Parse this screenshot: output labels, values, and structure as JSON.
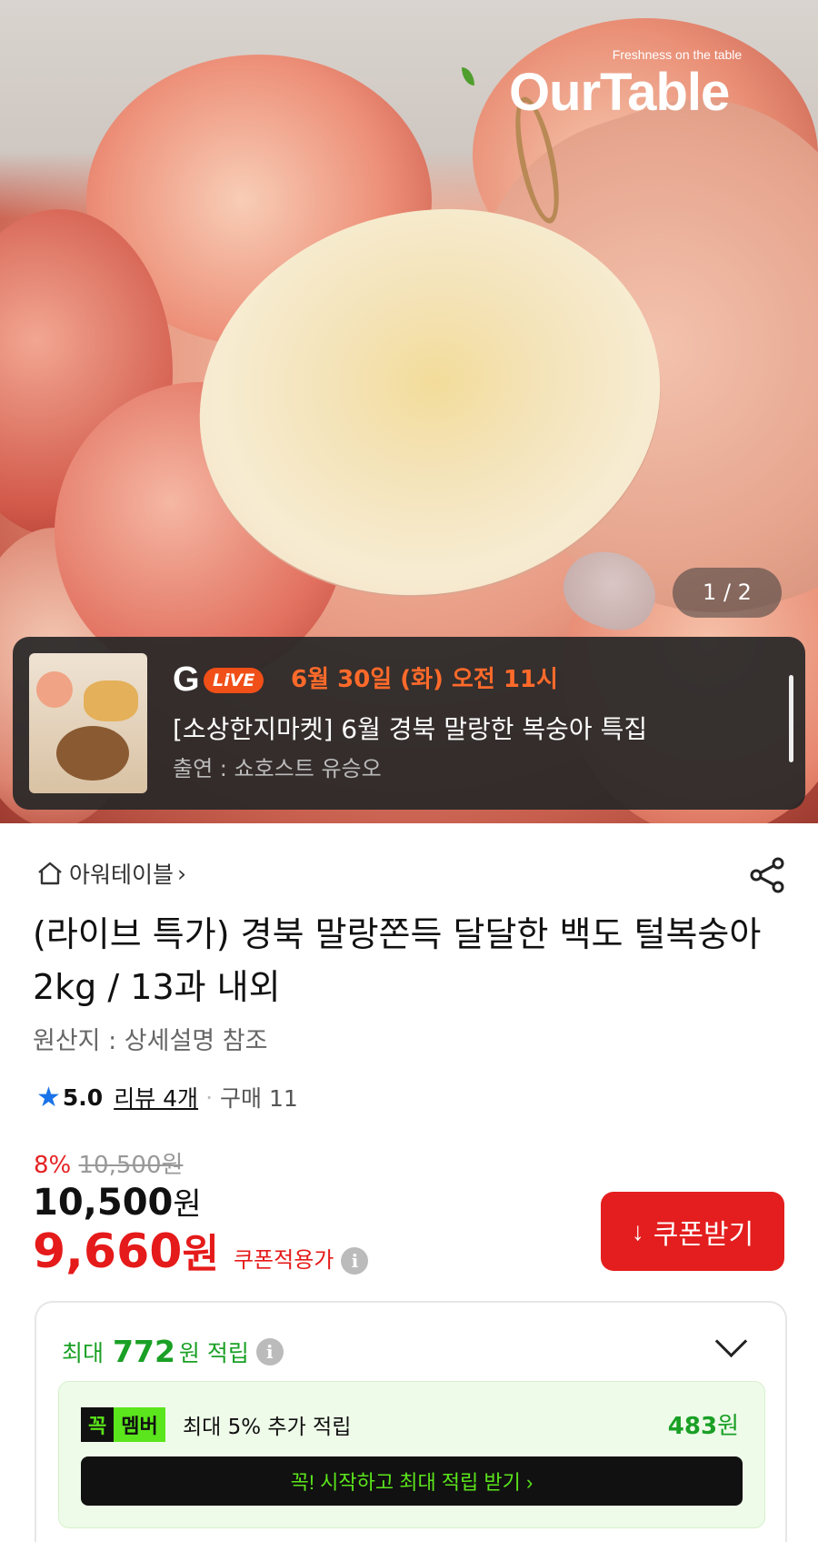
{
  "hero": {
    "logo_tagline": "Freshness on the table",
    "logo_text": "OurTable",
    "pager": "1 / 2"
  },
  "live": {
    "brand_g": "G",
    "brand_badge": "LiVE",
    "date": "6월 30일 (화) 오전 11시",
    "title": "[소상한지마켓] 6월 경북 말랑한 복숭아 특집",
    "cast": "출연 : 쇼호스트 유승오"
  },
  "product": {
    "seller": "아워테이블",
    "seller_chevron": "›",
    "title": "(라이브 특가) 경북 말랑쫀득 달달한 백도 털복숭아 2kg / 13과 내외",
    "origin": "원산지 : 상세설명 참조",
    "rating_star": "★",
    "rating": "5.0",
    "review": "리뷰 4개",
    "dot": "·",
    "purchases": "구매 11"
  },
  "pricing": {
    "discount_pct": "8%",
    "original_price": "10,500",
    "original_unit": "원",
    "price": "10,500",
    "price_unit": "원",
    "coupon_price": "9,660",
    "coupon_unit": "원",
    "coupon_label": "쿠폰적용가",
    "info_glyph": "i",
    "coupon_button": "쿠폰받기",
    "coupon_button_icon": "↓"
  },
  "points": {
    "prefix": "최대",
    "amount": "772",
    "suffix": "원 적립",
    "member_badge_1": "꼭",
    "member_badge_2": "멤버",
    "member_desc": "최대 5% 추가 적립",
    "member_amount": "483",
    "member_unit": "원",
    "cta": "꼭! 시작하고 최대 적립 받기 ›"
  },
  "colors": {
    "accent_red": "#e41e1e",
    "live_orange": "#ff6a2a",
    "point_green": "#1aa025",
    "member_lime": "#5be51c",
    "star_blue": "#1a73e8"
  }
}
